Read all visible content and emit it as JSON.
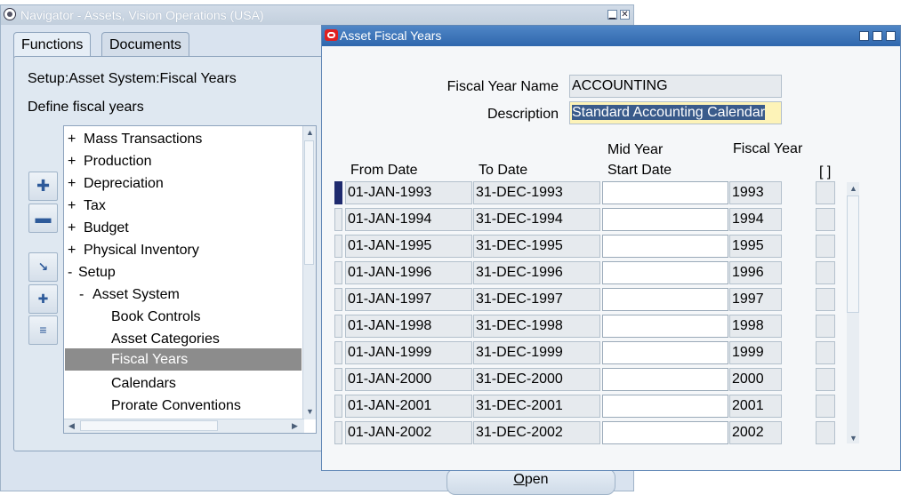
{
  "navigator": {
    "title": "Navigator - Assets, Vision Operations (USA)",
    "tabs": [
      {
        "label": "Functions",
        "active": true
      },
      {
        "label": "Documents",
        "active": false
      }
    ],
    "path": "Setup:Asset System:Fiscal Years",
    "description": "Define fiscal years",
    "tree": [
      {
        "prefix": "+",
        "label": "Mass Transactions",
        "selected": false
      },
      {
        "prefix": "+",
        "label": "Production",
        "selected": false
      },
      {
        "prefix": "+",
        "label": "Depreciation",
        "selected": false
      },
      {
        "prefix": "+",
        "label": "Tax",
        "selected": false
      },
      {
        "prefix": "+",
        "label": "Budget",
        "selected": false
      },
      {
        "prefix": "+",
        "label": "Physical Inventory",
        "selected": false
      },
      {
        "prefix": "-",
        "label": "Setup",
        "selected": false
      },
      {
        "prefix": "-",
        "label": "Asset System",
        "selected": false
      },
      {
        "prefix": "",
        "label": "Book Controls",
        "selected": false
      },
      {
        "prefix": "",
        "label": "Asset Categories",
        "selected": false
      },
      {
        "prefix": "",
        "label": "Fiscal Years",
        "selected": true
      },
      {
        "prefix": "",
        "label": "Calendars",
        "selected": false
      },
      {
        "prefix": "",
        "label": "Prorate Conventions",
        "selected": false
      }
    ],
    "side_buttons": [
      "expand-icon",
      "collapse-icon",
      "expand-branch-icon",
      "expand-all-icon",
      "collapse-all-icon"
    ],
    "open_label": "Open",
    "open_mnemonic": "O",
    "open_rest": "pen"
  },
  "fiscal_years": {
    "title": "Asset Fiscal Years",
    "fiscal_year_name_label": "Fiscal Year Name",
    "fiscal_year_name": "ACCOUNTING",
    "description_label": "Description",
    "description": "Standard Accounting Calendar",
    "columns": {
      "from_date": "From Date",
      "to_date": "To Date",
      "mid_year_1": "Mid Year",
      "mid_year_2": "Start Date",
      "fiscal_year": "Fiscal Year",
      "flex": "[ ]"
    },
    "rows": [
      {
        "from": "01-JAN-1993",
        "to": "31-DEC-1993",
        "mid": "",
        "year": "1993"
      },
      {
        "from": "01-JAN-1994",
        "to": "31-DEC-1994",
        "mid": "",
        "year": "1994"
      },
      {
        "from": "01-JAN-1995",
        "to": "31-DEC-1995",
        "mid": "",
        "year": "1995"
      },
      {
        "from": "01-JAN-1996",
        "to": "31-DEC-1996",
        "mid": "",
        "year": "1996"
      },
      {
        "from": "01-JAN-1997",
        "to": "31-DEC-1997",
        "mid": "",
        "year": "1997"
      },
      {
        "from": "01-JAN-1998",
        "to": "31-DEC-1998",
        "mid": "",
        "year": "1998"
      },
      {
        "from": "01-JAN-1999",
        "to": "31-DEC-1999",
        "mid": "",
        "year": "1999"
      },
      {
        "from": "01-JAN-2000",
        "to": "31-DEC-2000",
        "mid": "",
        "year": "2000"
      },
      {
        "from": "01-JAN-2001",
        "to": "31-DEC-2001",
        "mid": "",
        "year": "2001"
      },
      {
        "from": "01-JAN-2002",
        "to": "31-DEC-2002",
        "mid": "",
        "year": "2002"
      }
    ]
  },
  "colors": {
    "titlebar_active": "#2f67ad",
    "selection": "#8c8c8c",
    "current_row": "#1e2a6e",
    "highlight_field": "#fdf3b8"
  }
}
